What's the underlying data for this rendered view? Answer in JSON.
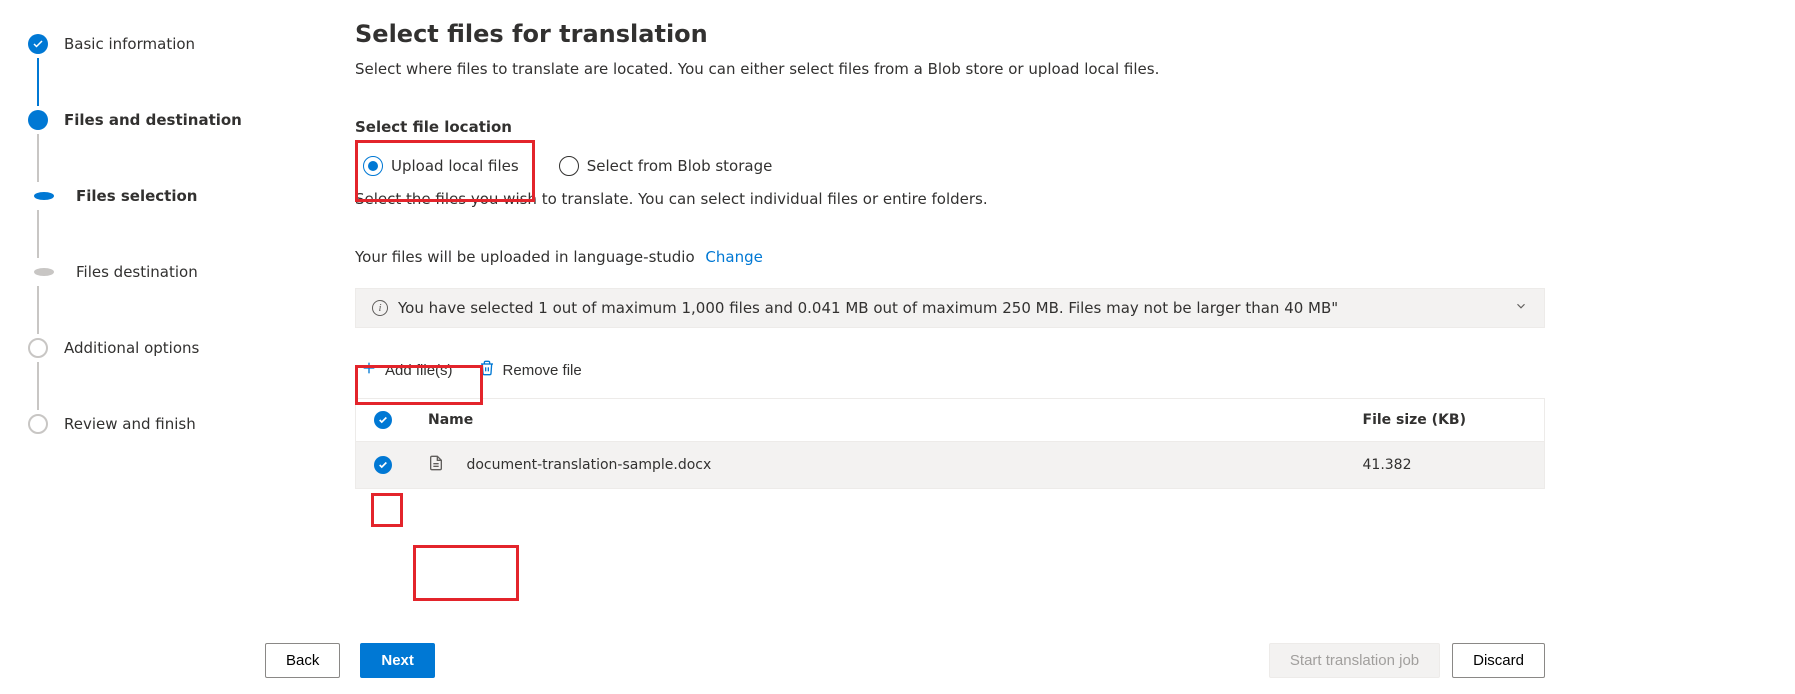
{
  "wizard": {
    "steps": [
      {
        "label": "Basic information",
        "state": "completed"
      },
      {
        "label": "Files and destination",
        "state": "current"
      },
      {
        "label": "Files selection",
        "state": "sub-current"
      },
      {
        "label": "Files destination",
        "state": "sub-future"
      },
      {
        "label": "Additional options",
        "state": "future"
      },
      {
        "label": "Review and finish",
        "state": "future"
      }
    ]
  },
  "page": {
    "title": "Select files for translation",
    "description": "Select where files to translate are located. You can either select files from a Blob store or upload local files.",
    "file_location_label": "Select file location",
    "radios": {
      "upload_local": "Upload local files",
      "blob_storage": "Select from Blob storage"
    },
    "helper_text": "Select the files you wish to translate. You can select individual files or entire folders.",
    "upload_note_prefix": "Your files will be uploaded in language-studio",
    "upload_note_link": "Change",
    "banner_text": "You have selected 1 out of maximum 1,000 files and 0.041 MB out of maximum 250 MB. Files may not be larger than 40 MB\"",
    "toolbar": {
      "add_files": "Add file(s)",
      "remove_file": "Remove file"
    },
    "table": {
      "columns": {
        "name": "Name",
        "size": "File size (KB)"
      },
      "rows": [
        {
          "name": "document-translation-sample.docx",
          "size": "41.382",
          "selected": true
        }
      ]
    }
  },
  "footer": {
    "back": "Back",
    "next": "Next",
    "start_job": "Start translation job",
    "discard": "Discard"
  }
}
